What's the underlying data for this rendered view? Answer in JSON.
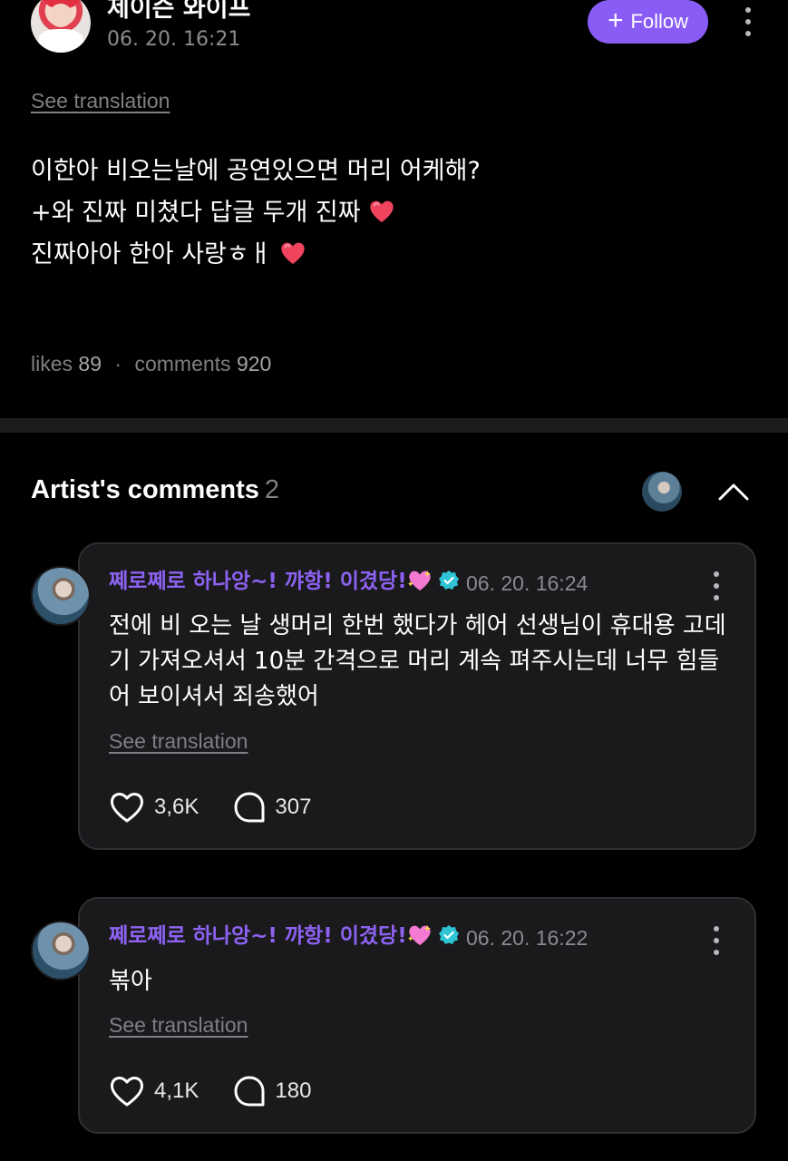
{
  "post": {
    "author_name": "제이슨 와이프",
    "time": "06. 20. 16:21",
    "follow_label": "Follow",
    "see_translation": "See translation",
    "lines": [
      "이한아 비오는날에 공연있으면 머리 어케해?",
      "+와 진짜 미쳤다 답글 두개 진짜",
      "진짜아아 한아 사랑ㅎㅐ"
    ],
    "likes_label": "likes",
    "likes": "89",
    "comments_label": "comments",
    "comments": "920"
  },
  "artist_comments": {
    "title": "Artist's comments",
    "count": "2",
    "items": [
      {
        "name": "쩨로쩨로 하나앙~! 꺄항! 이겼당!",
        "time": "06. 20. 16:24",
        "text": "전에 비 오는 날 생머리 한번 했다가 헤어 선생님이 휴대용 고데기 가져오셔서 10분 간격으로 머리 계속 펴주시는데 너무 힘들어 보이셔서 죄송했어",
        "see_translation": "See translation",
        "likes": "3,6K",
        "replies": "307"
      },
      {
        "name": "쩨로쩨로 하나앙~! 꺄항! 이겼당!",
        "time": "06. 20. 16:22",
        "text": "볶아",
        "see_translation": "See translation",
        "likes": "4,1K",
        "replies": "180"
      }
    ]
  },
  "colors": {
    "accent": "#8a5cf6",
    "name_purple": "#8d62f2",
    "card_bg": "#1a1a1c",
    "verified": "#2ec4d6"
  },
  "icons": [
    "plus-icon",
    "more-vertical-icon",
    "red-heart-emoji",
    "chevron-up-icon",
    "sparkling-heart-emoji",
    "verified-badge-icon",
    "heart-outline-icon",
    "comment-bubble-icon"
  ]
}
